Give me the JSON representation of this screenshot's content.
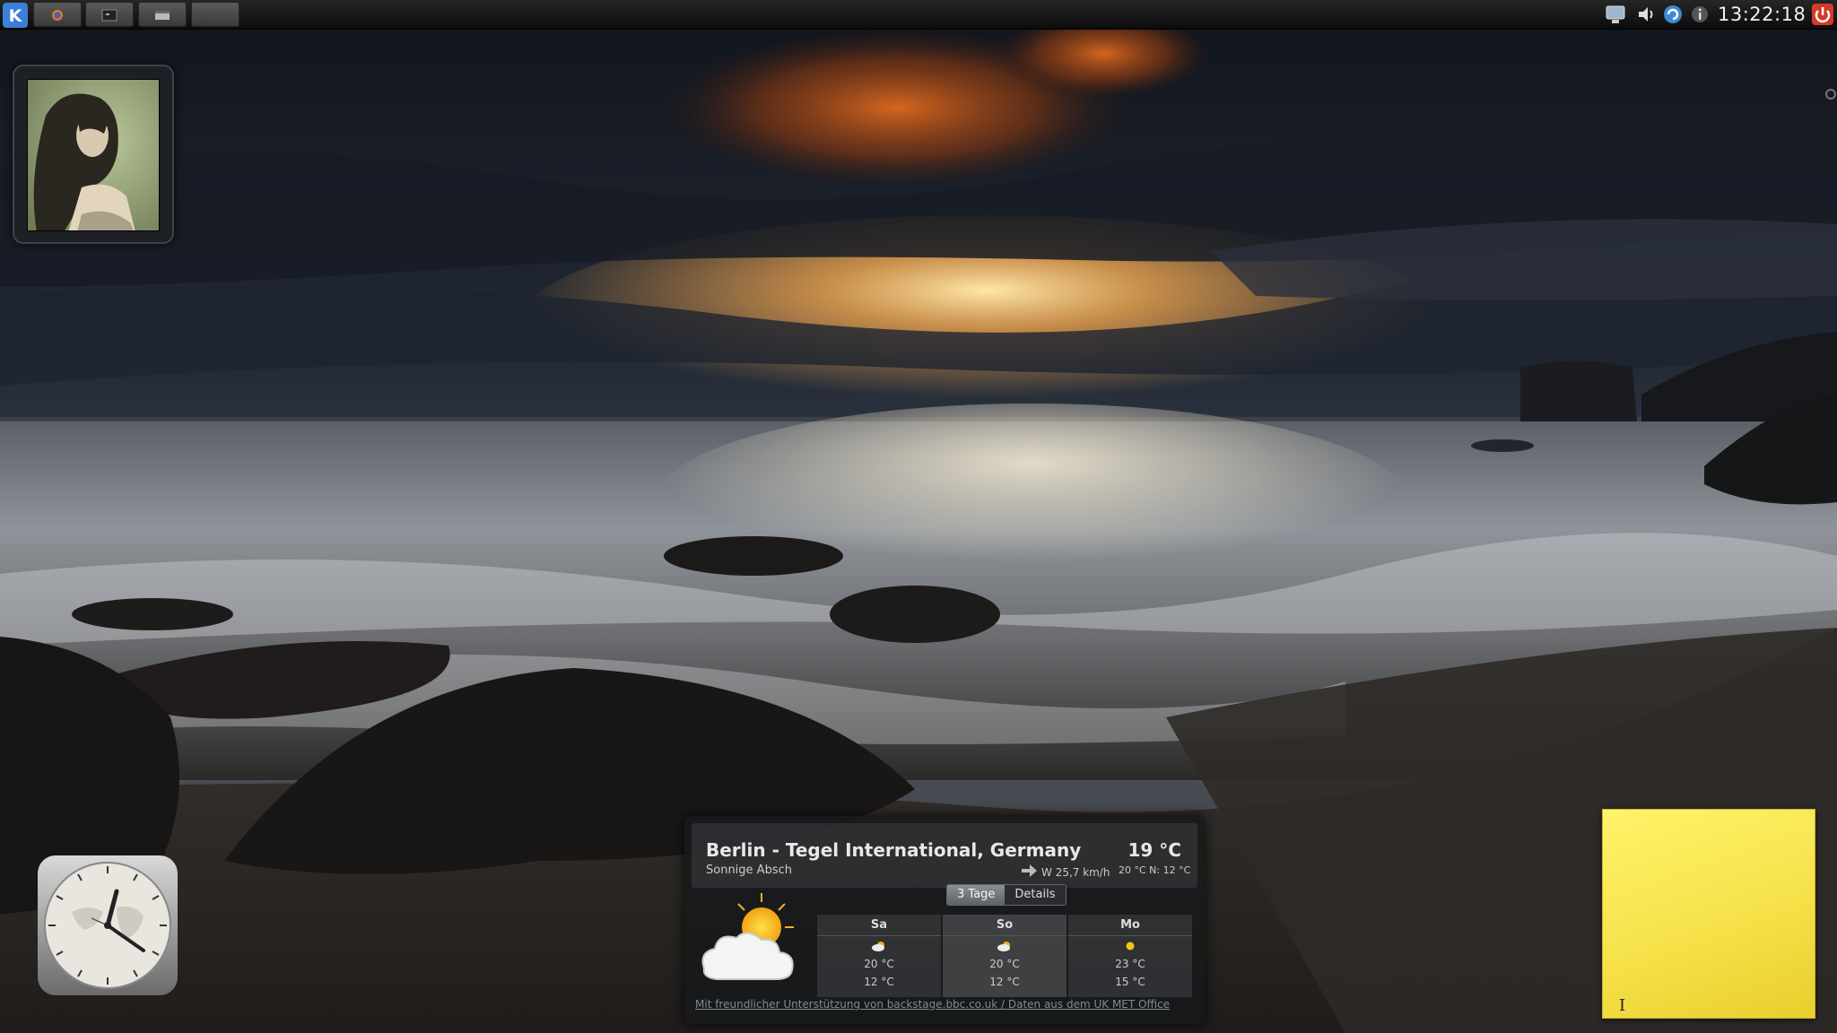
{
  "panel": {
    "clock": "13:22:18",
    "tasks": [
      "firefox-task",
      "terminal-task",
      "files-task",
      "blank-task"
    ]
  },
  "weather": {
    "location": "Berlin - Tegel International, Germany",
    "condition": "Sonnige Absch",
    "current_temp": "19 °C",
    "wind": "W 25,7 km/h",
    "high_low": "20 °C N: 12 °C",
    "tabs": [
      {
        "label": "3 Tage",
        "active": true
      },
      {
        "label": "Details",
        "active": false
      }
    ],
    "forecast": [
      {
        "day": "Sa",
        "icon": "cloud-sun-icon",
        "high": "20 °C",
        "low": "12 °C"
      },
      {
        "day": "So",
        "icon": "cloud-sun-icon",
        "high": "20 °C",
        "low": "12 °C"
      },
      {
        "day": "Mo",
        "icon": "sun-icon",
        "high": "23 °C",
        "low": "15 °C"
      }
    ],
    "credit": "Mit freundlicher Unterstützung von backstage.bbc.co.uk / Daten aus dem UK MET Office"
  },
  "note": {
    "text": ""
  },
  "colors": {
    "note_yellow": "#f6e14a",
    "panel_bg": "#1a1a1a",
    "kde_blue": "#3b7fd6",
    "power_red": "#d43a2a"
  }
}
